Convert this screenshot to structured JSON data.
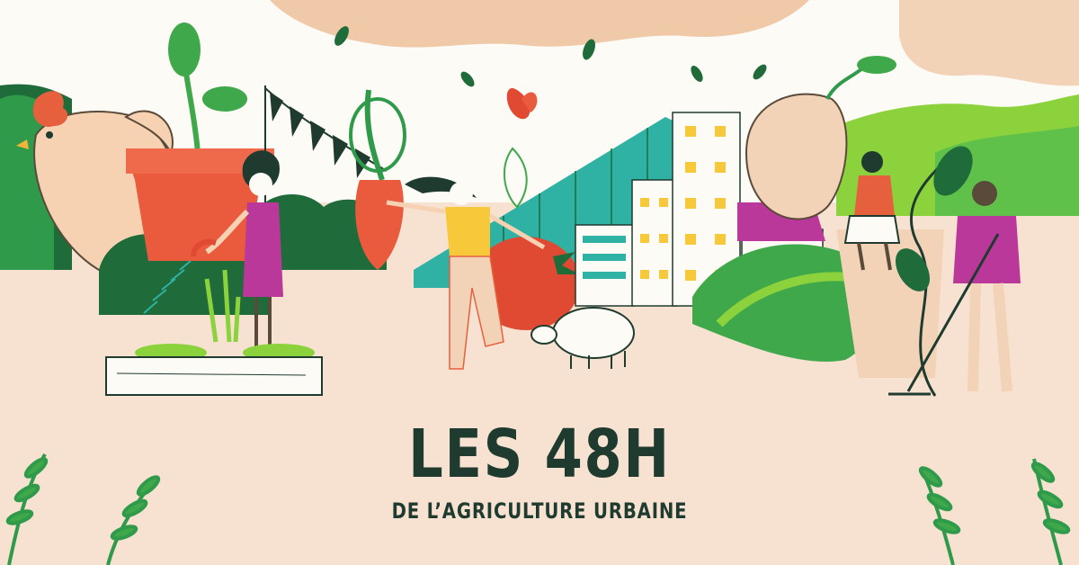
{
  "banner": {
    "title": "LES 48H",
    "subtitle": "DE L’AGRICULTURE URBAINE"
  },
  "colors": {
    "background": "#f7e2d2",
    "sky": "#fdfbf6",
    "cloud": "#f0c9a8",
    "title": "#1f3b2f",
    "green_dark": "#1f6b3a",
    "green_mid": "#2e9a4a",
    "green_light": "#8bd23c",
    "pot_red": "#ea5a3d",
    "tomato_red": "#e04a33",
    "building_yellow": "#f6c83a",
    "building_teal": "#2fb2a4",
    "roof_magenta": "#b9389a"
  },
  "illustration": {
    "elements": [
      "chicken",
      "flower-pot",
      "bunting-flags",
      "gardener-woman-watering",
      "raised-garden-bed",
      "carrot",
      "dancing-woman",
      "tomato",
      "sheep",
      "greenhouse",
      "city-buildings",
      "small-house",
      "seed",
      "man-sitting-on-pot",
      "man-with-rake",
      "plant-vine",
      "corner-ferns-left",
      "corner-ferns-right",
      "butterfly",
      "falling-leaves"
    ]
  }
}
